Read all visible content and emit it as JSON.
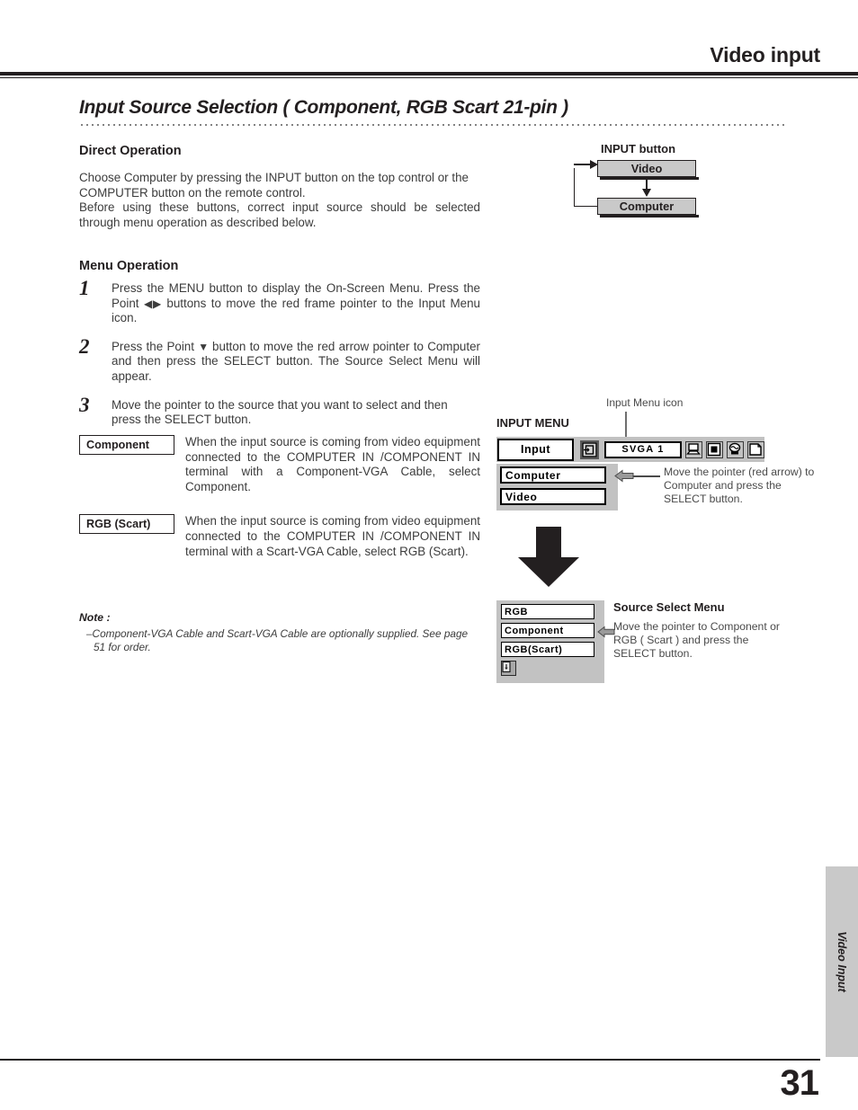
{
  "header": {
    "title": "Video input"
  },
  "section": {
    "title": "Input Source Selection ( Component, RGB Scart 21-pin )"
  },
  "direct_operation": {
    "heading": "Direct Operation",
    "paragraph": "Choose Computer by pressing the INPUT button on the top control or the COMPUTER button on the remote control.",
    "paragraph2": "Before using these buttons, correct input source should be selected through menu operation as described below."
  },
  "menu_operation": {
    "heading": "Menu Operation",
    "steps": [
      {
        "number": "1",
        "text_a": "Press the MENU button to display the On-Screen Menu.  Press the Point ",
        "glyph": "◀▶",
        "text_b": " buttons to move the red frame pointer to the Input Menu icon."
      },
      {
        "number": "2",
        "text_a": "Press the Point ",
        "glyph": "▼",
        "text_b": " button to move the red arrow pointer to Computer and then press the SELECT button.  The Source Select Menu will appear."
      },
      {
        "number": "3",
        "text_a": "Move the pointer to the source that you want to select and then press the SELECT button.",
        "glyph": "",
        "text_b": ""
      }
    ]
  },
  "definitions": [
    {
      "label": "Component",
      "text": "When the input source is coming from video equipment connected to the COMPUTER IN /COMPONENT IN terminal with a Component-VGA Cable, select Component."
    },
    {
      "label": "RGB (Scart)",
      "text": "When the input source is coming from video equipment connected to the COMPUTER IN /COMPONENT IN terminal with a Scart-VGA Cable, select RGB (Scart)."
    }
  ],
  "note": {
    "heading": "Note :",
    "body": "–Component-VGA Cable and Scart-VGA Cable are optionally supplied.  See page 51 for order."
  },
  "input_button_diagram": {
    "caption": "INPUT button",
    "box_video": "Video",
    "box_computer": "Computer"
  },
  "input_menu": {
    "icon_caption": "Input Menu icon",
    "heading": "INPUT MENU",
    "input_field": "Input",
    "source_field": "SVGA 1",
    "icons": [
      "input-menu-icon",
      "computer-menu-icon",
      "screen-menu-icon",
      "color-menu-icon",
      "page-menu-icon"
    ],
    "items": [
      "Computer",
      "Video"
    ],
    "pointer_note": "Move the pointer (red arrow) to Computer and press the SELECT button."
  },
  "source_select": {
    "heading": "Source Select Menu",
    "note": "Move the pointer to Component or RGB ( Scart ) and press the SELECT button.",
    "items": [
      "RGB",
      "Component",
      "RGB(Scart)"
    ],
    "exit_icon": "exit-door-icon"
  },
  "side_tab": {
    "label": "Video Input"
  },
  "footer": {
    "page_number": "31"
  },
  "colors": {
    "ink": "#231f20",
    "body_text": "#3c3c3c",
    "osd_gray": "#c2c2c2",
    "flow_gray": "#c9c9c9"
  }
}
